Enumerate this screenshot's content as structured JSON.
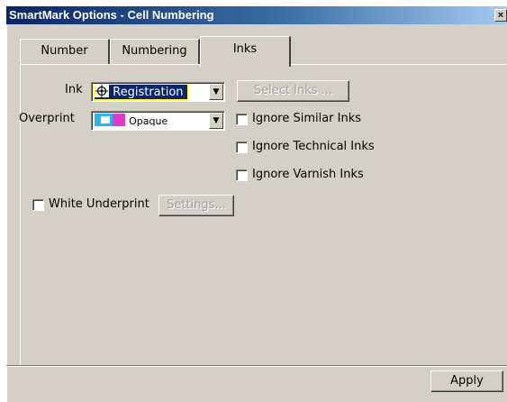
{
  "window": {
    "title": "SmartMark Options - Cell Numbering",
    "close_glyph": "×"
  },
  "tabs": [
    {
      "label": "Number",
      "active": false
    },
    {
      "label": "Numbering",
      "active": false
    },
    {
      "label": "Inks",
      "active": true
    }
  ],
  "inks_panel": {
    "ink_label": "Ink",
    "ink_value": "Registration",
    "select_inks_label": "Select Inks ...",
    "overprint_label": "Overprint",
    "overprint_value": "Opaque",
    "ignore_similar_label": "Ignore Similar Inks",
    "ignore_technical_label": "Ignore Technical Inks",
    "ignore_varnish_label": "Ignore Varnish Inks",
    "white_underprint_label": "White Underprint",
    "settings_label": "Settings..."
  },
  "footer": {
    "apply_label": "Apply"
  },
  "icons": {
    "registration": "registration-mark-icon",
    "opaque": "opaque-swatch-icon",
    "dropdown": "chevron-down-icon"
  }
}
